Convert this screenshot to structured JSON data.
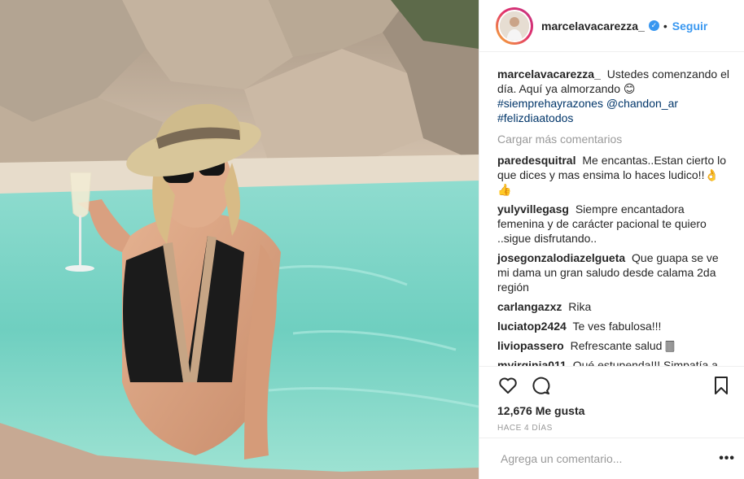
{
  "post": {
    "username": "marcelavacarezza_",
    "verified_mark": "✓",
    "dot": "•",
    "follow_label": "Seguir",
    "caption": {
      "username": "marcelavacarezza_",
      "text": "Ustedes comenzando el día. Aquí ya almorzando 😊",
      "hashtag1": "#siemprehayrazones",
      "mention": "@chandon_ar",
      "hashtag2": "#felizdiaatodos"
    },
    "load_more": "Cargar más comentarios",
    "comments": [
      {
        "user": "paredesquitral",
        "text": "Me encantas..Estan cierto lo que dices y mas ensima lo haces ludico!!👌👍"
      },
      {
        "user": "yulyvillegasg",
        "text": "Siempre encantadora femenina y de carácter pacional te quiero ..sigue disfrutando.."
      },
      {
        "user": "josegonzalodiazelgueta",
        "text": "Que guapa se ve mi dama un gran saludo desde calama 2da región"
      },
      {
        "user": "carlangazxz",
        "text": "Rika"
      },
      {
        "user": "luciatop2424",
        "text": "Te ves fabulosa!!!"
      },
      {
        "user": "liviopassero",
        "text": "Refrescante salud 🀫"
      },
      {
        "user": "myirginia011",
        "text": "Qué estupenda!!! Simpatía a"
      }
    ],
    "likes": "12,676 Me gusta",
    "time": "HACE 4 DÍAS",
    "comment_placeholder": "Agrega un comentario...",
    "more_label": "•••"
  },
  "icons": {
    "like": "heart-icon",
    "comment": "speech-bubble-icon",
    "save": "bookmark-icon"
  },
  "colors": {
    "accent": "#3897f0",
    "muted": "#999999",
    "text": "#262626",
    "hashtag": "#003569",
    "pool": "#7fd3c4",
    "rock": "#c9b6a4"
  }
}
